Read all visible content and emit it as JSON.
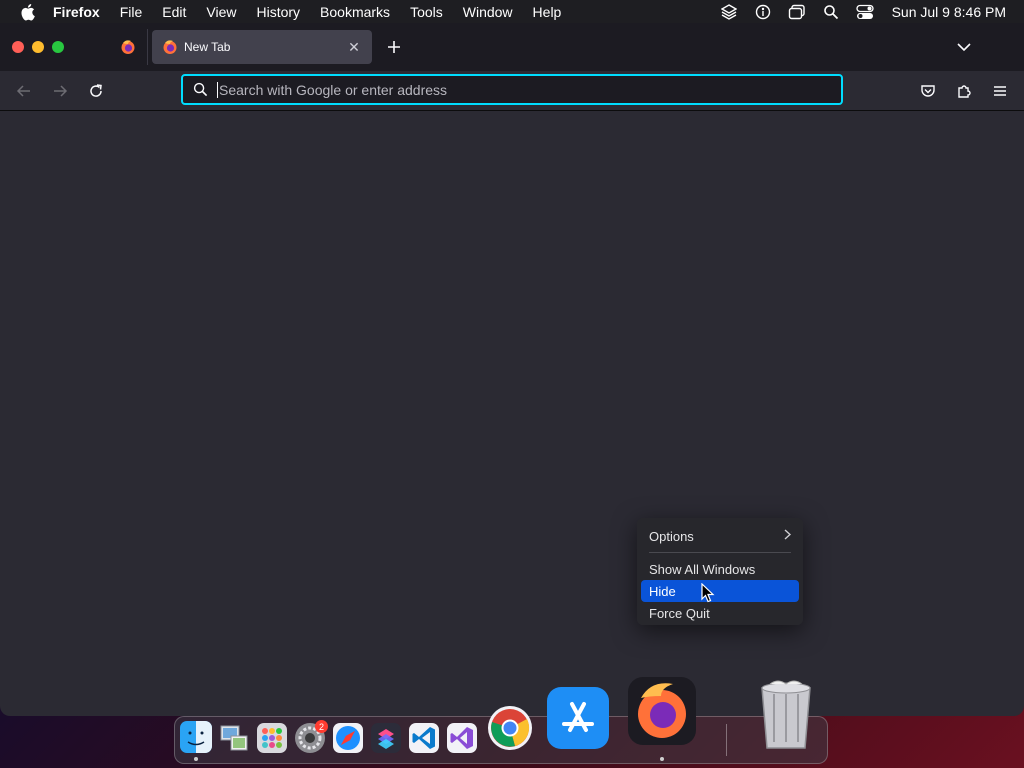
{
  "menubar": {
    "app_name": "Firefox",
    "items": [
      "File",
      "Edit",
      "View",
      "History",
      "Bookmarks",
      "Tools",
      "Window",
      "Help"
    ],
    "clock": "Sun Jul 9  8:46 PM"
  },
  "browser": {
    "active_tab": {
      "title": "New Tab"
    },
    "urlbar": {
      "placeholder": "Search with Google or enter address",
      "value": ""
    }
  },
  "context_menu": {
    "items": [
      {
        "label": "Options",
        "submenu": true
      },
      {
        "label": "Show All Windows"
      },
      {
        "label": "Hide",
        "highlighted": true
      },
      {
        "label": "Force Quit"
      }
    ]
  },
  "dock": {
    "apps": [
      "Finder",
      "Preview",
      "Launchpad",
      "System Settings",
      "Safari",
      "Shortcuts",
      "Visual Studio Code",
      "Visual Studio",
      "Google Chrome",
      "App Store",
      "Firefox",
      "Trash"
    ],
    "system_settings_badge": "2"
  },
  "colors": {
    "accent": "#00ddff",
    "menu_highlight": "#0a54d8",
    "window_bg": "#2b2a33",
    "tabbar_bg": "#1c1b22"
  }
}
